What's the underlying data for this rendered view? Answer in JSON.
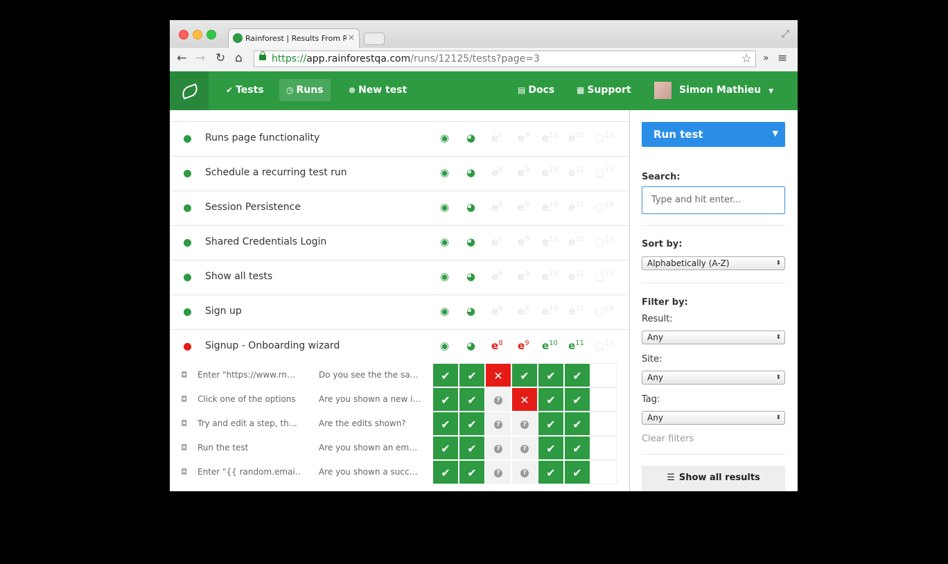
{
  "browser": {
    "tab_title": "Rainforest | Results From R",
    "tab_close": "×",
    "url_scheme": "https://",
    "url_domain": "app.rainforestqa.com",
    "url_path": "/runs/12125/tests?page=3",
    "icons": {
      "back": "←",
      "forward": "→",
      "reload": "↻",
      "home": "⌂",
      "star": "☆",
      "extensions": "»",
      "menu": "≡",
      "fullscreen": "⤢"
    }
  },
  "nav": {
    "tests": "Tests",
    "runs": "Runs",
    "new_test": "New test",
    "docs": "Docs",
    "support": "Support",
    "user_name": "Simon Mathieu",
    "icons": {
      "tests": "✔",
      "runs": "◷",
      "new_test": "⊕",
      "docs": "▤",
      "support": "▦",
      "caret": "▼"
    }
  },
  "tests": [
    {
      "name": "Runs page functionality",
      "status": "pass"
    },
    {
      "name": "Schedule a recurring test run",
      "status": "pass"
    },
    {
      "name": "Session Persistence",
      "status": "pass"
    },
    {
      "name": "Shared Credentials Login",
      "status": "pass"
    },
    {
      "name": "Show all tests",
      "status": "pass"
    },
    {
      "name": "Sign up",
      "status": "pass"
    },
    {
      "name": "Signup - Onboarding wizard",
      "status": "fail"
    }
  ],
  "browser_icons": {
    "chrome": "◉",
    "firefox": "◕",
    "ie": "e",
    "safari": "▢",
    "ie8": "8",
    "ie9": "9",
    "ie10": "10",
    "ie11": "11",
    "safari_ver": "13"
  },
  "steps": [
    {
      "action": "Enter \"https://www.rn…",
      "question": "Do you see the the sa…",
      "results": [
        "pass",
        "pass",
        "fail",
        "pass",
        "pass",
        "pass",
        "empty"
      ]
    },
    {
      "action": "Click one of the options",
      "question": "Are you shown a new i…",
      "results": [
        "pass",
        "pass",
        "unknown",
        "fail",
        "pass",
        "pass",
        "empty"
      ]
    },
    {
      "action": "Try and edit a step, th…",
      "question": "Are the edits shown?",
      "results": [
        "pass",
        "pass",
        "unknown",
        "unknown",
        "pass",
        "pass",
        "empty"
      ]
    },
    {
      "action": "Run the test",
      "question": "Are you shown an em…",
      "results": [
        "pass",
        "pass",
        "unknown",
        "unknown",
        "pass",
        "pass",
        "empty"
      ]
    },
    {
      "action": "Enter \"{{ random.emai…",
      "question": "Are you shown a succ…",
      "results": [
        "pass",
        "pass",
        "unknown",
        "unknown",
        "pass",
        "pass",
        "empty"
      ]
    }
  ],
  "result_glyphs": {
    "pass": "✔",
    "fail": "✕",
    "unknown": "?",
    "empty": ""
  },
  "sidebar": {
    "run_test": "Run test",
    "run_caret": "▼",
    "search_label": "Search:",
    "search_placeholder": "Type and hit enter...",
    "sort_label": "Sort by:",
    "sort_value": "Alphabetically (A-Z)",
    "filter_label": "Filter by:",
    "result_label": "Result:",
    "result_value": "Any",
    "site_label": "Site:",
    "site_value": "Any",
    "tag_label": "Tag:",
    "tag_value": "Any",
    "select_arrow": "⬍",
    "clear_filters": "Clear filters",
    "show_all": "Show all results",
    "show_all_icon": "☰"
  },
  "colors": {
    "brand_green": "#2e9a42",
    "fail_red": "#e51b16",
    "primary_blue": "#2a8de6"
  }
}
